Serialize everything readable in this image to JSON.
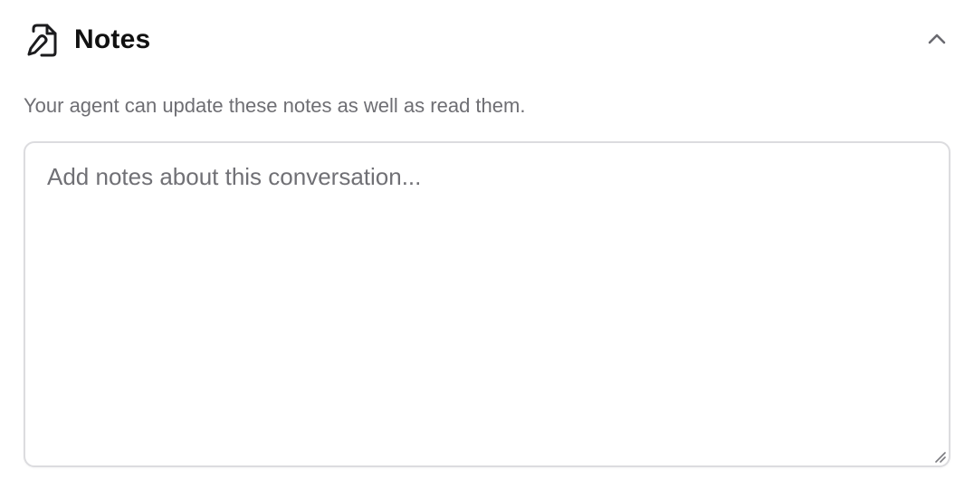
{
  "notes": {
    "title": "Notes",
    "title_icon": "file-edit-icon",
    "collapse_icon": "chevron-up-icon",
    "description": "Your agent can update these notes as well as read them.",
    "textarea": {
      "value": "",
      "placeholder": "Add notes about this conversation..."
    },
    "resize_icon": "resize-grip-icon"
  },
  "colors": {
    "title": "#111111",
    "description": "#6e6e73",
    "placeholder": "#707075",
    "border": "#dcdcdf",
    "icon": "#1c1c1e",
    "chevron": "#6a6a70"
  }
}
